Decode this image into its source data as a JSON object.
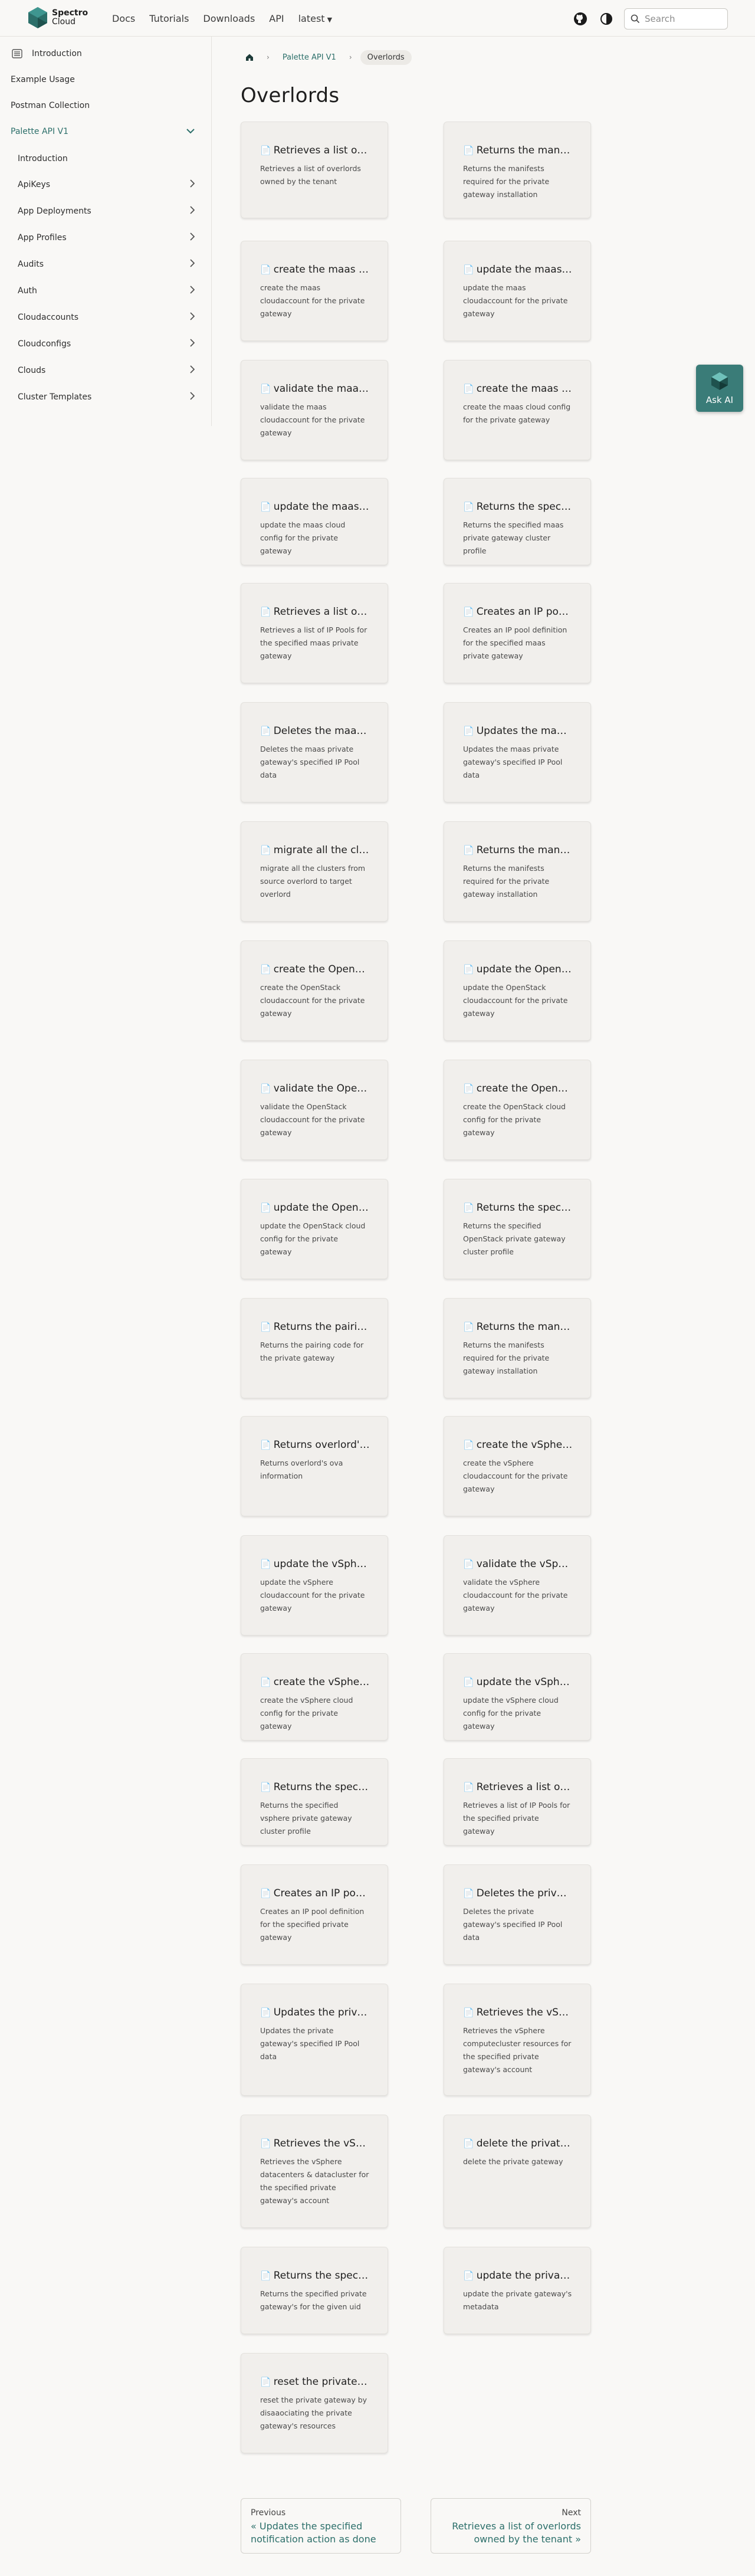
{
  "brand": {
    "line1": "Spectro",
    "line2": "Cloud",
    "color": "#2c6f6a"
  },
  "nav": {
    "links": [
      "Docs",
      "Tutorials",
      "Downloads",
      "API"
    ],
    "version": "latest",
    "search_placeholder": "Search"
  },
  "sidebar": {
    "items": [
      {
        "label": "Introduction",
        "icon": "menu-icon"
      },
      {
        "label": "Example Usage"
      },
      {
        "label": "Postman Collection"
      },
      {
        "label": "Palette API V1",
        "expanded": true,
        "active": true
      },
      {
        "label": "Introduction"
      },
      {
        "label": "ApiKeys",
        "has_children": true
      },
      {
        "label": "App Deployments",
        "has_children": true
      },
      {
        "label": "App Profiles",
        "has_children": true
      },
      {
        "label": "Audits",
        "has_children": true
      },
      {
        "label": "Auth",
        "has_children": true
      },
      {
        "label": "Cloudaccounts",
        "has_children": true
      },
      {
        "label": "Cloudconfigs",
        "has_children": true
      },
      {
        "label": "Clouds",
        "has_children": true
      },
      {
        "label": "Cluster Templates",
        "has_children": true
      }
    ]
  },
  "breadcrumb": {
    "parent": "Palette API V1",
    "current": "Overlords"
  },
  "page": {
    "title": "Overlords"
  },
  "cards": [
    {
      "title": "Retrieves a list of overlords",
      "desc": "Retrieves a list of overlords owned by the tenant"
    },
    {
      "title": "Returns the manifests",
      "desc": "Returns the manifests required for the private gateway installation"
    },
    {
      "title": "create the maas cloudaccount",
      "desc": "create the maas cloudaccount for the private gateway"
    },
    {
      "title": "update the maas cloudaccount",
      "desc": "update the maas cloudaccount for the private gateway"
    },
    {
      "title": "validate the maas cloudaccount",
      "desc": "validate the maas cloudaccount for the private gateway"
    },
    {
      "title": "create the maas cloud config",
      "desc": "create the maas cloud config for the private gateway"
    },
    {
      "title": "update the maas cloud config",
      "desc": "update the maas cloud config for the private gateway"
    },
    {
      "title": "Returns the specified maas",
      "desc": "Returns the specified maas private gateway cluster profile"
    },
    {
      "title": "Retrieves a list of IP Pools",
      "desc": "Retrieves a list of IP Pools for the specified maas private gateway"
    },
    {
      "title": "Creates an IP pool definition",
      "desc": "Creates an IP pool definition for the specified maas private gateway"
    },
    {
      "title": "Deletes the maas private",
      "desc": "Deletes the maas private gateway's specified IP Pool data"
    },
    {
      "title": "Updates the maas private",
      "desc": "Updates the maas private gateway's specified IP Pool data"
    },
    {
      "title": "migrate all the clusters",
      "desc": "migrate all the clusters from source overlord to target overlord"
    },
    {
      "title": "Returns the manifests",
      "desc": "Returns the manifests required for the private gateway installation"
    },
    {
      "title": "create the OpenStack",
      "desc": "create the OpenStack cloudaccount for the private gateway"
    },
    {
      "title": "update the OpenStack",
      "desc": "update the OpenStack cloudaccount for the private gateway"
    },
    {
      "title": "validate the OpenStack",
      "desc": "validate the OpenStack cloudaccount for the private gateway"
    },
    {
      "title": "create the OpenStack cloud",
      "desc": "create the OpenStack cloud config for the private gateway"
    },
    {
      "title": "update the OpenStack cloud",
      "desc": "update the OpenStack cloud config for the private gateway"
    },
    {
      "title": "Returns the specified",
      "desc": "Returns the specified OpenStack private gateway cluster profile"
    },
    {
      "title": "Returns the pairing code",
      "desc": "Returns the pairing code for the private gateway"
    },
    {
      "title": "Returns the manifests",
      "desc": "Returns the manifests required for the private gateway installation"
    },
    {
      "title": "Returns overlord's ova",
      "desc": "Returns overlord's ova information"
    },
    {
      "title": "create the vSphere cloudaccount",
      "desc": "create the vSphere cloudaccount for the private gateway"
    },
    {
      "title": "update the vSphere cloudaccount",
      "desc": "update the vSphere cloudaccount for the private gateway"
    },
    {
      "title": "validate the vSphere cloudaccount",
      "desc": "validate the vSphere cloudaccount for the private gateway"
    },
    {
      "title": "create the vSphere cloud config",
      "desc": "create the vSphere cloud config for the private gateway"
    },
    {
      "title": "update the vSphere cloud config",
      "desc": "update the vSphere cloud config for the private gateway"
    },
    {
      "title": "Returns the specified vsphere",
      "desc": "Returns the specified vsphere private gateway cluster profile"
    },
    {
      "title": "Retrieves a list of IP Pools",
      "desc": "Retrieves a list of IP Pools for the specified private gateway"
    },
    {
      "title": "Creates an IP pool definition",
      "desc": "Creates an IP pool definition for the specified private gateway"
    },
    {
      "title": "Deletes the private gateway's",
      "desc": "Deletes the private gateway's specified IP Pool data"
    },
    {
      "title": "Updates the private gateway's",
      "desc": "Updates the private gateway's specified IP Pool data"
    },
    {
      "title": "Retrieves the vSphere",
      "desc": "Retrieves the vSphere computecluster resources for the specified private gateway's account"
    },
    {
      "title": "Retrieves the vSphere",
      "desc": "Retrieves the vSphere datacenters & datacluster for the specified private gateway's account"
    },
    {
      "title": "delete the private gateway",
      "desc": "delete the private gateway"
    },
    {
      "title": "Returns the specified",
      "desc": "Returns the specified private gateway's for the given uid"
    },
    {
      "title": "update the private gateway",
      "desc": "update the private gateway's metadata"
    },
    {
      "title": "reset the private gateway",
      "desc": "reset the private gateway by disaaociating the private gateway's resources"
    }
  ],
  "ask_ai": {
    "label": "Ask AI"
  },
  "pager": {
    "prev_label": "Previous",
    "prev_title": "« Updates the specified notification action as done",
    "next_label": "Next",
    "next_title": "Retrieves a list of overlords owned by the tenant »"
  }
}
